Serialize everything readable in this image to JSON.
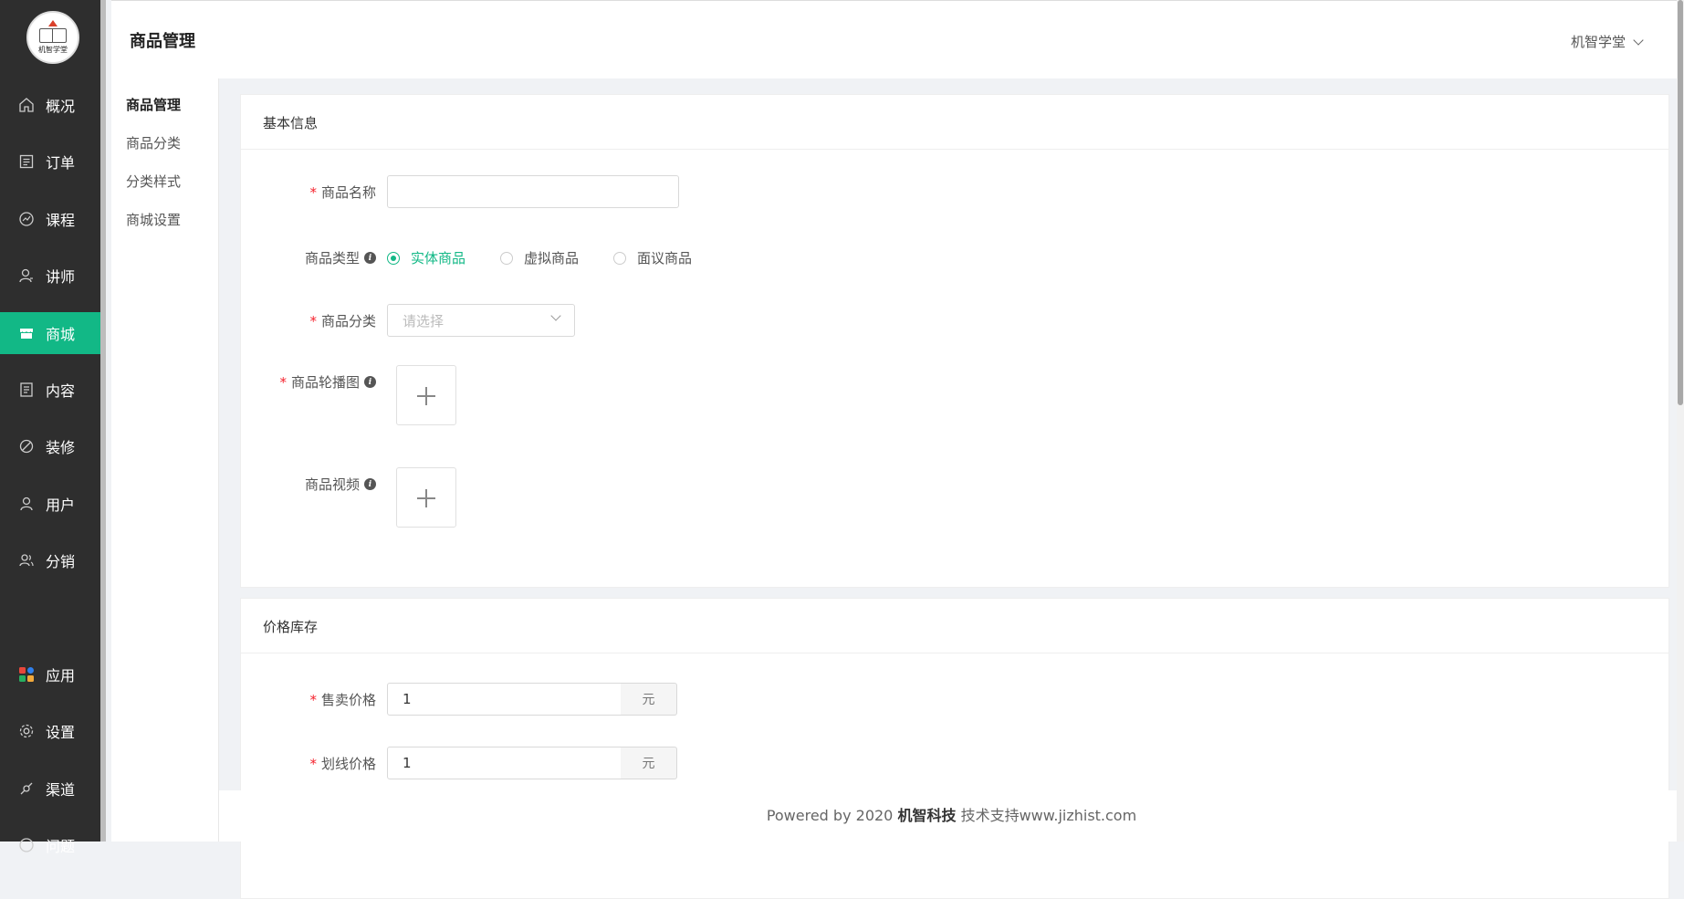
{
  "logo": {
    "text": "机智学堂"
  },
  "sidebar": {
    "items": [
      {
        "label": "概况",
        "icon": "home-icon"
      },
      {
        "label": "订单",
        "icon": "order-icon"
      },
      {
        "label": "课程",
        "icon": "course-icon"
      },
      {
        "label": "讲师",
        "icon": "teacher-icon"
      },
      {
        "label": "商城",
        "icon": "store-icon",
        "active": true
      },
      {
        "label": "内容",
        "icon": "content-icon"
      },
      {
        "label": "装修",
        "icon": "decorate-icon"
      },
      {
        "label": "用户",
        "icon": "user-icon"
      },
      {
        "label": "分销",
        "icon": "distribution-icon"
      },
      {
        "label": "应用",
        "icon": "apps-icon"
      },
      {
        "label": "设置",
        "icon": "gear-icon"
      },
      {
        "label": "渠道",
        "icon": "channel-icon"
      },
      {
        "label": "问题",
        "icon": "question-icon"
      }
    ]
  },
  "header": {
    "title": "商品管理",
    "user": "机智学堂"
  },
  "subnav": {
    "items": [
      {
        "label": "商品管理",
        "active": true
      },
      {
        "label": "商品分类"
      },
      {
        "label": "分类样式"
      },
      {
        "label": "商城设置"
      }
    ]
  },
  "basic": {
    "title": "基本信息",
    "name_label": "商品名称",
    "name_value": "",
    "type_label": "商品类型",
    "type_options": [
      "实体商品",
      "虚拟商品",
      "面议商品"
    ],
    "type_selected": "实体商品",
    "category_label": "商品分类",
    "category_placeholder": "请选择",
    "carousel_label": "商品轮播图",
    "video_label": "商品视频"
  },
  "price": {
    "title": "价格库存",
    "sell_label": "售卖价格",
    "sell_value": "1",
    "strike_label": "划线价格",
    "strike_value": "1",
    "unit": "元"
  },
  "footer": {
    "prefix": "Powered by 2020",
    "company": "机智科技",
    "suffix": "技术支持www.jizhist.com"
  },
  "colors": {
    "accent": "#12b886",
    "sidebar": "#2e2e2e",
    "required": "#f5222d"
  }
}
